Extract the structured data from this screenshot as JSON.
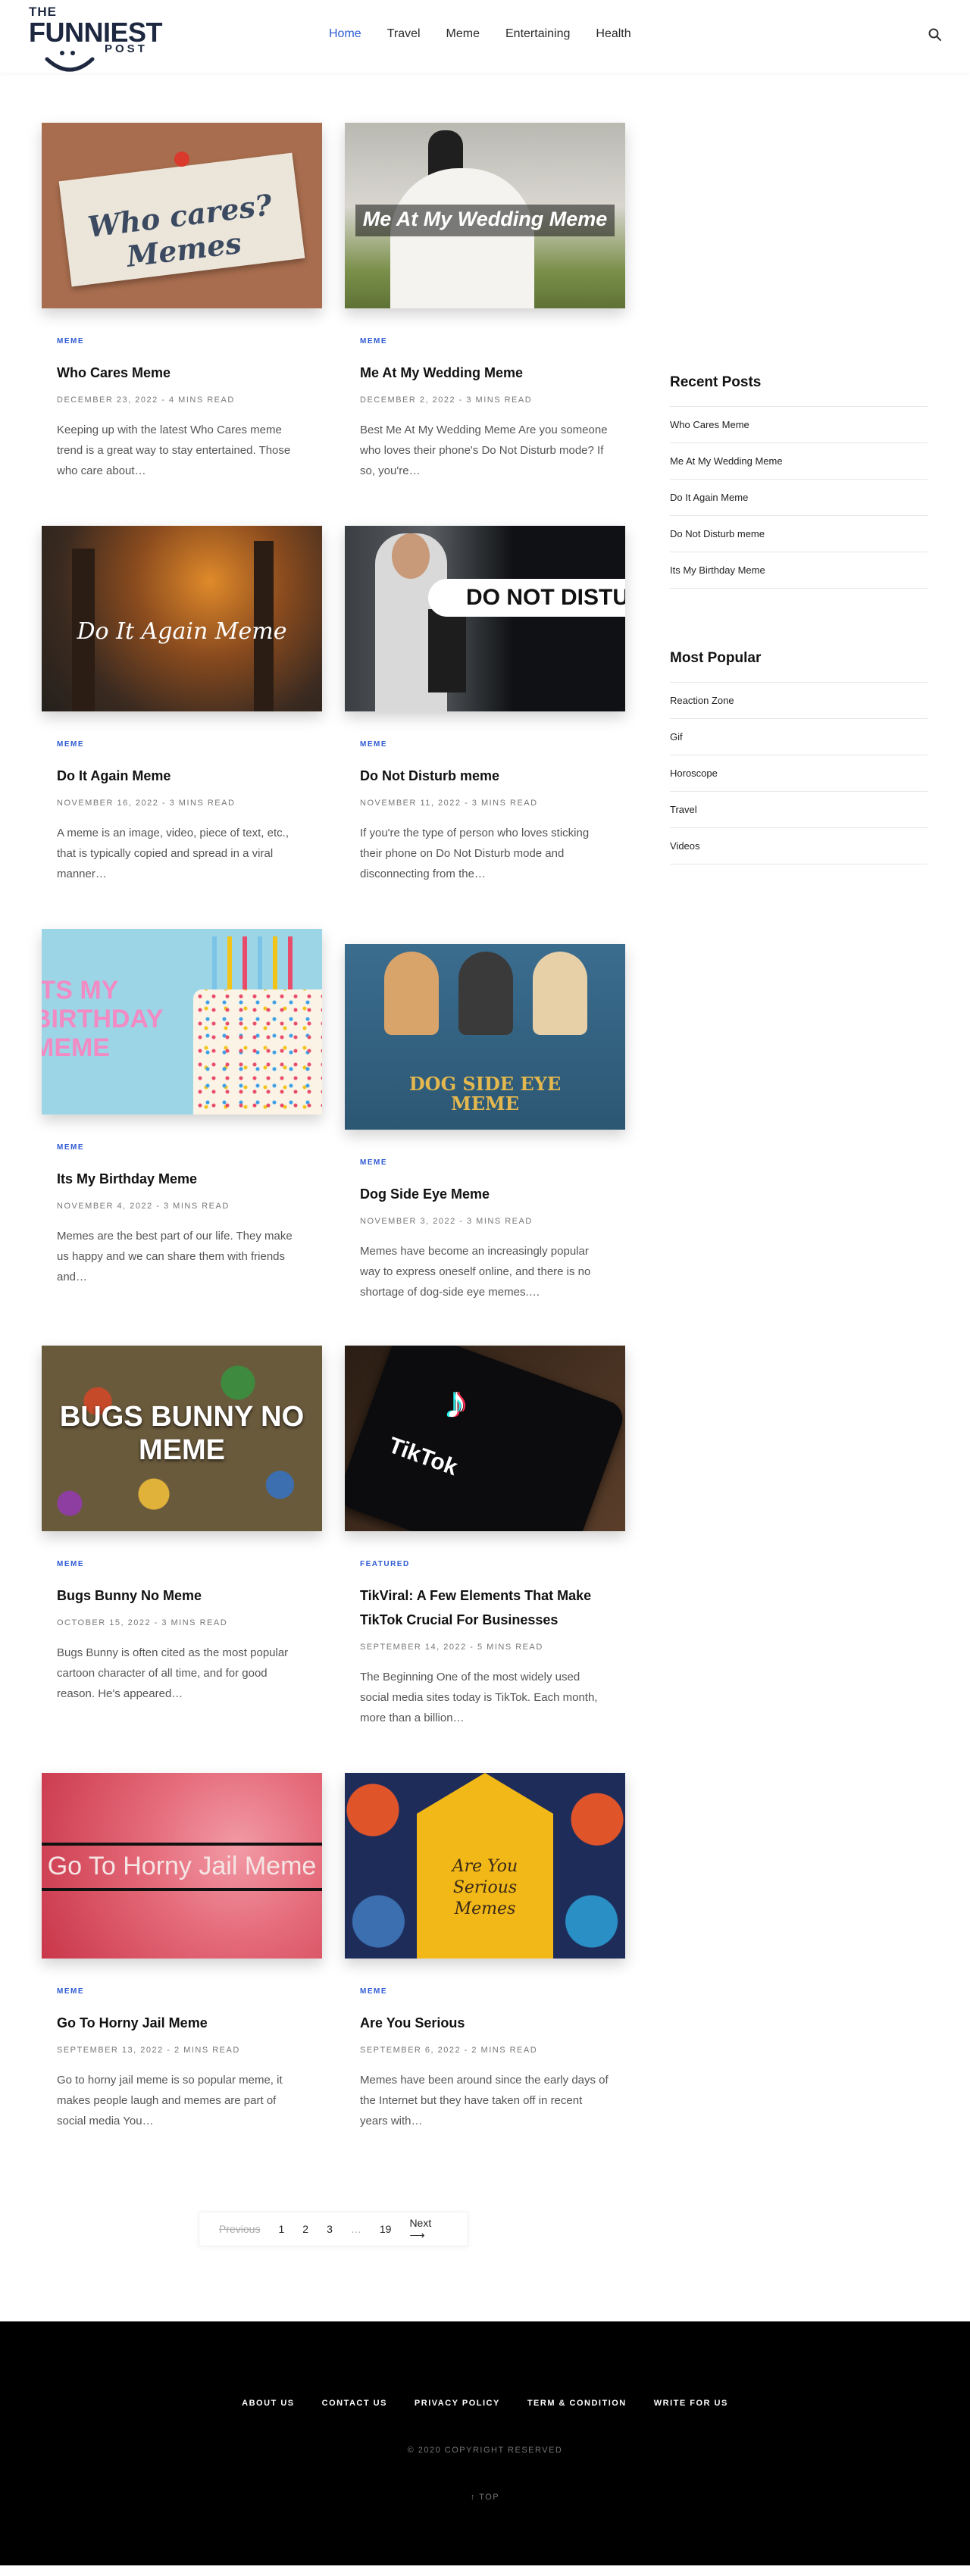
{
  "header": {
    "logo": {
      "line1": "THE",
      "line2": "FUNNIEST",
      "line3": "POST"
    },
    "nav": [
      "Home",
      "Travel",
      "Meme",
      "Entertaining",
      "Health"
    ],
    "active_nav": "Home",
    "search_icon": "search-icon"
  },
  "posts": [
    {
      "category": "MEME",
      "title": "Who Cares Meme",
      "date": "DECEMBER 23, 2022 - 4 MINS READ",
      "excerpt": "Keeping up with the latest Who Cares meme trend is a great way to stay entertained. Those who care about…",
      "image_text": "Who cares? Memes"
    },
    {
      "category": "MEME",
      "title": "Me At My Wedding Meme",
      "date": "DECEMBER 2, 2022 - 3 MINS READ",
      "excerpt": "Best Me At My Wedding Meme Are you someone who loves their phone's Do Not Disturb mode? If so, you're…",
      "image_text": "Me At My Wedding Meme"
    },
    {
      "category": "MEME",
      "title": "Do It Again Meme",
      "date": "NOVEMBER 16, 2022 - 3 MINS READ",
      "excerpt": "A meme is an image, video, piece of text, etc., that is typically copied and spread in a viral manner…",
      "image_text": "Do It Again Meme"
    },
    {
      "category": "MEME",
      "title": "Do Not Disturb meme",
      "date": "NOVEMBER 11, 2022 - 3 MINS READ",
      "excerpt": "If you're the type of person who loves sticking their phone on Do Not Disturb mode and disconnecting from the…",
      "image_text": "DO NOT DISTU"
    },
    {
      "category": "MEME",
      "title": "Its My Birthday Meme",
      "date": "NOVEMBER 4, 2022 - 3 MINS READ",
      "excerpt": "Memes are the best part of our life. They make us happy and we can share them with friends and…",
      "image_text": "ITS MY BIRTHDAY MEME"
    },
    {
      "category": "MEME",
      "title": "Dog Side Eye Meme",
      "date": "NOVEMBER 3, 2022 - 3 MINS READ",
      "excerpt": "Memes have become an increasingly popular way to express oneself online, and there is no shortage of dog-side eye memes.…",
      "image_text": "DOG SIDE EYE MEME"
    },
    {
      "category": "MEME",
      "title": "Bugs Bunny No Meme",
      "date": "OCTOBER 15, 2022 - 3 MINS READ",
      "excerpt": "Bugs Bunny is often cited as the most popular cartoon character of all time, and for good reason. He's appeared…",
      "image_text": "BUGS BUNNY NO MEME"
    },
    {
      "category": "FEATURED",
      "title": "TikViral: A Few Elements That Make TikTok Crucial For Businesses",
      "date": "SEPTEMBER 14, 2022 - 5 MINS READ",
      "excerpt": "The Beginning  One of the most widely used social media sites today is TikTok. Each month, more than a billion…",
      "image_text": "TikTok"
    },
    {
      "category": "MEME",
      "title": "Go To Horny Jail Meme",
      "date": "SEPTEMBER 13, 2022 - 2 MINS READ",
      "excerpt": "Go to horny jail meme is so popular meme, it makes people laugh and memes are part of social media You…",
      "image_text": "Go To Horny Jail Meme"
    },
    {
      "category": "MEME",
      "title": "Are You Serious",
      "date": "SEPTEMBER 6, 2022 - 2 MINS READ",
      "excerpt": "Memes have been around since the early days of the Internet but they have taken off in recent years with…",
      "image_text": "Are You Serious Memes"
    }
  ],
  "sidebar": {
    "recent_title": "Recent Posts",
    "recent": [
      "Who Cares Meme",
      "Me At My Wedding Meme",
      "Do It Again Meme",
      "Do Not Disturb meme",
      "Its My Birthday Meme"
    ],
    "popular_title": "Most Popular",
    "popular": [
      "Reaction Zone",
      "Gif",
      "Horoscope",
      "Travel",
      "Videos"
    ]
  },
  "pagination": {
    "previous": "Previous",
    "pages": [
      "1",
      "2",
      "3",
      "…",
      "19"
    ],
    "next": "Next ⟶"
  },
  "footer": {
    "links": [
      "ABOUT US",
      "CONTACT US",
      "PRIVACY POLICY",
      "TERM & CONDITION",
      "WRITE FOR US"
    ],
    "copyright": "© 2020 COPYRIGHT RESERVED",
    "to_top": "↑ TOP"
  },
  "colors": {
    "accent": "#2f5bd3",
    "footer_bg": "#000000",
    "logo": "#1d2840"
  }
}
